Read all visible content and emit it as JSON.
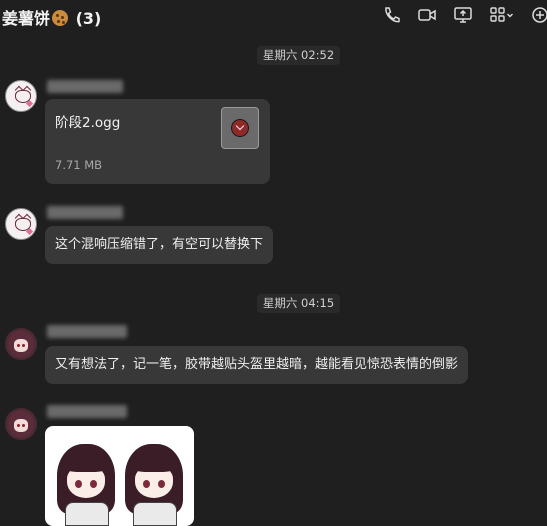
{
  "header": {
    "title": "姜薯饼",
    "unread_count": "(3)",
    "title_emoji": "cookie-icon",
    "icons": [
      "phone-icon",
      "video-call-icon",
      "screen-share-icon",
      "apps-icon",
      "add-people-icon"
    ]
  },
  "messages": {
    "sep1": "星期六 02:52",
    "file": {
      "name": "阶段2.ogg",
      "size": "7.71 MB"
    },
    "msg2": "这个混响压缩错了，有空可以替换下",
    "sep2": "星期六 04:15",
    "msg3": "又有想法了，记一笔，胶带越贴头盔里越暗，越能看见惊恐表情的倒影"
  },
  "colors": {
    "background": "#1f1f1f",
    "bubble": "#383838",
    "text": "#f0f0f0"
  }
}
